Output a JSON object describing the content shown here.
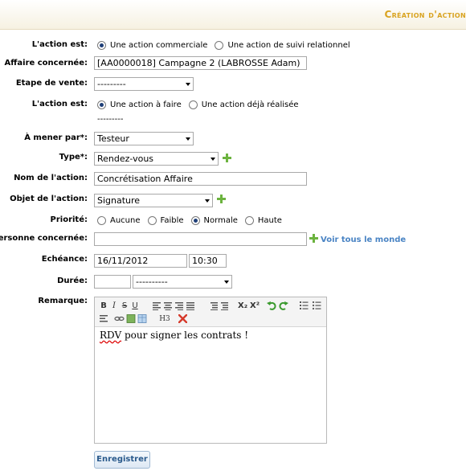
{
  "header": {
    "title": "Création d'action"
  },
  "form": {
    "action_type": {
      "label": "L'action est:",
      "options": [
        "Une action commerciale",
        "Une action de suivi relationnel"
      ],
      "selected": "Une action commerciale"
    },
    "affaire": {
      "label": "Affaire concernée:",
      "value": "[AA0000018] Campagne 2 (LABROSSE Adam)"
    },
    "etape": {
      "label": "Etape de vente:",
      "value": "---------"
    },
    "action_state": {
      "label": "L'action est:",
      "options": [
        "Une action à faire",
        "Une action déjà réalisée"
      ],
      "selected": "Une action à faire",
      "sub_value": "---------"
    },
    "mener_par": {
      "label": "À mener par*:",
      "value": "Testeur"
    },
    "type": {
      "label": "Type*:",
      "value": "Rendez-vous"
    },
    "nom": {
      "label": "Nom de l'action:",
      "value": "Concrétisation Affaire"
    },
    "objet": {
      "label": "Objet de l'action:",
      "value": "Signature"
    },
    "priorite": {
      "label": "Priorité:",
      "options": [
        "Aucune",
        "Faible",
        "Normale",
        "Haute"
      ],
      "selected": "Normale"
    },
    "personne": {
      "label": "Personne concernée:",
      "value": "",
      "link": "Voir tous le monde"
    },
    "echeance": {
      "label": "Echéance:",
      "date": "16/11/2012",
      "time": "10:30"
    },
    "duree": {
      "label": "Durée:",
      "value": "",
      "unit": "----------"
    },
    "remarque": {
      "label": "Remarque:",
      "content_word": "RDV",
      "content_rest": " pour signer les contrats !",
      "toolbar": {
        "bold": "B",
        "italic": "I",
        "strike": "S",
        "underline": "U",
        "subscript": "X₂",
        "superscript": "X²",
        "heading": "H3"
      }
    }
  },
  "buttons": {
    "save": "Enregistrer"
  },
  "colors": {
    "header_title": "#d9a320",
    "link": "#4a84c4",
    "plus": "#6cb33f"
  }
}
